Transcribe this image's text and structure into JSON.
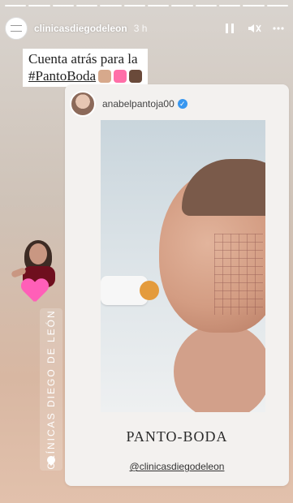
{
  "header": {
    "username": "clinicasdiegodeleon",
    "time": "3 h",
    "icons": [
      "pause-icon",
      "mute-icon",
      "more-icon"
    ]
  },
  "caption": {
    "line1": "Cuenta atrás para la",
    "hashtag": "#PantoBoda"
  },
  "shared_post": {
    "username": "anabelpantoja00",
    "verified": true,
    "title": "PANTO-BODA",
    "mention": "@clinicasdiegodeleon"
  },
  "location_sticker": {
    "text": "CLÍNICAS DIEGO DE LEÓN"
  },
  "colors": {
    "verified": "#3897f0",
    "heart": "#ff5fb8"
  }
}
